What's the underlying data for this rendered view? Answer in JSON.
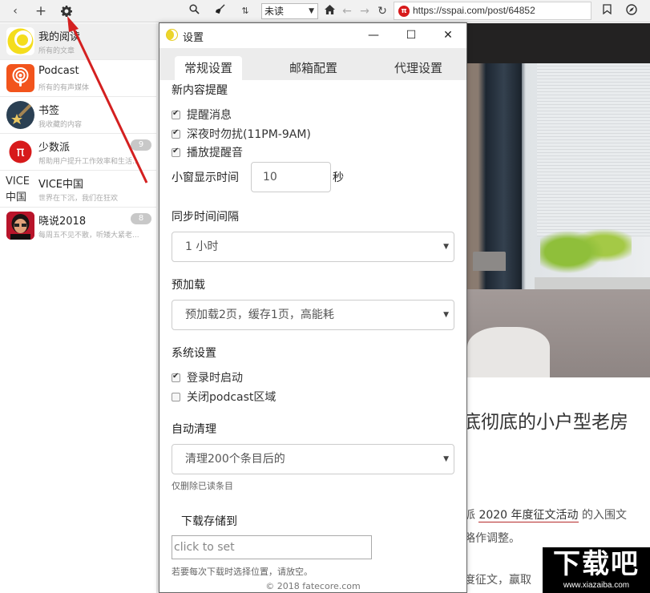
{
  "toolbar": {
    "back_icon": "chevron-left-icon",
    "add_icon": "plus-icon",
    "settings_icon": "gear-icon",
    "search_icon": "search-icon",
    "clean_icon": "broom-icon",
    "sort_icon": "sort-arrows-icon",
    "filter_value": "未读",
    "home_icon": "home-icon",
    "nav_back_icon": "arrow-left-icon",
    "nav_forward_icon": "arrow-right-icon",
    "reload_icon": "reload-icon",
    "url": "https://sspai.com/post/64852",
    "bookmark_icon": "bookmark-icon",
    "compass_icon": "compass-icon"
  },
  "sidebar": {
    "feeds": [
      {
        "title": "我的阅读",
        "subtitle": "所有的文章",
        "badge": null,
        "active": true
      },
      {
        "title": "Podcast",
        "subtitle": "所有的有声媒体",
        "badge": null
      },
      {
        "title": "书签",
        "subtitle": "我收藏的内容",
        "badge": null
      },
      {
        "title": "少数派",
        "subtitle": "帮助用户提升工作效率和生活...",
        "badge": "9"
      },
      {
        "title": "VICE中国",
        "subtitle": "世界在下沉，我们在狂欢",
        "badge": null,
        "avatar_text_line1": "VICE",
        "avatar_text_line2": "中国"
      },
      {
        "title": "晓说2018",
        "subtitle": "每周五不见不散，听矮大紧老...",
        "badge": "8"
      }
    ]
  },
  "dialog": {
    "title": "设置",
    "minimize_label": "—",
    "maximize_label": "☐",
    "close_label": "✕",
    "tabs": [
      {
        "label": "常规设置",
        "active": true
      },
      {
        "label": "邮箱配置",
        "active": false
      },
      {
        "label": "代理设置",
        "active": false
      }
    ],
    "notify_section": "新内容提醒",
    "notify_options": [
      {
        "label": "提醒消息",
        "checked": true
      },
      {
        "label": "深夜时勿扰(11PM-9AM)",
        "checked": true
      },
      {
        "label": "播放提醒音",
        "checked": true
      }
    ],
    "popup_time_label": "小窗显示时间",
    "popup_time_value": "10",
    "popup_time_unit": "秒",
    "sync_section": "同步时间间隔",
    "sync_value": "1 小时",
    "preload_section": "预加载",
    "preload_value": "预加载2页，缓存1页，高能耗",
    "system_section": "系统设置",
    "system_options": [
      {
        "label": "登录时启动",
        "checked": true
      },
      {
        "label": "关闭podcast区域",
        "checked": false
      }
    ],
    "cleanup_section": "自动清理",
    "cleanup_value": "清理200个条目后的",
    "cleanup_hint": "仅删除已读条目",
    "download_section": "下载存储到",
    "download_placeholder": "click to set",
    "download_hint": "若要每次下载时选择位置，请放空。",
    "footer": "© 2018 fatecore.com"
  },
  "article": {
    "headline": "底彻底的小户型老房",
    "p1_prefix": "派 ",
    "p1_link": "2020 年度征文活动",
    "p1_suffix": " 的入围文",
    "p2": "略作调整。",
    "p3": "度征文，赢取"
  },
  "watermark": {
    "big": "下载吧",
    "small": "www.xiazaiba.com"
  },
  "colors": {
    "accent_red": "#d71a1b",
    "annotation_arrow": "#d42020",
    "badge_gray": "#c8c8c8"
  }
}
